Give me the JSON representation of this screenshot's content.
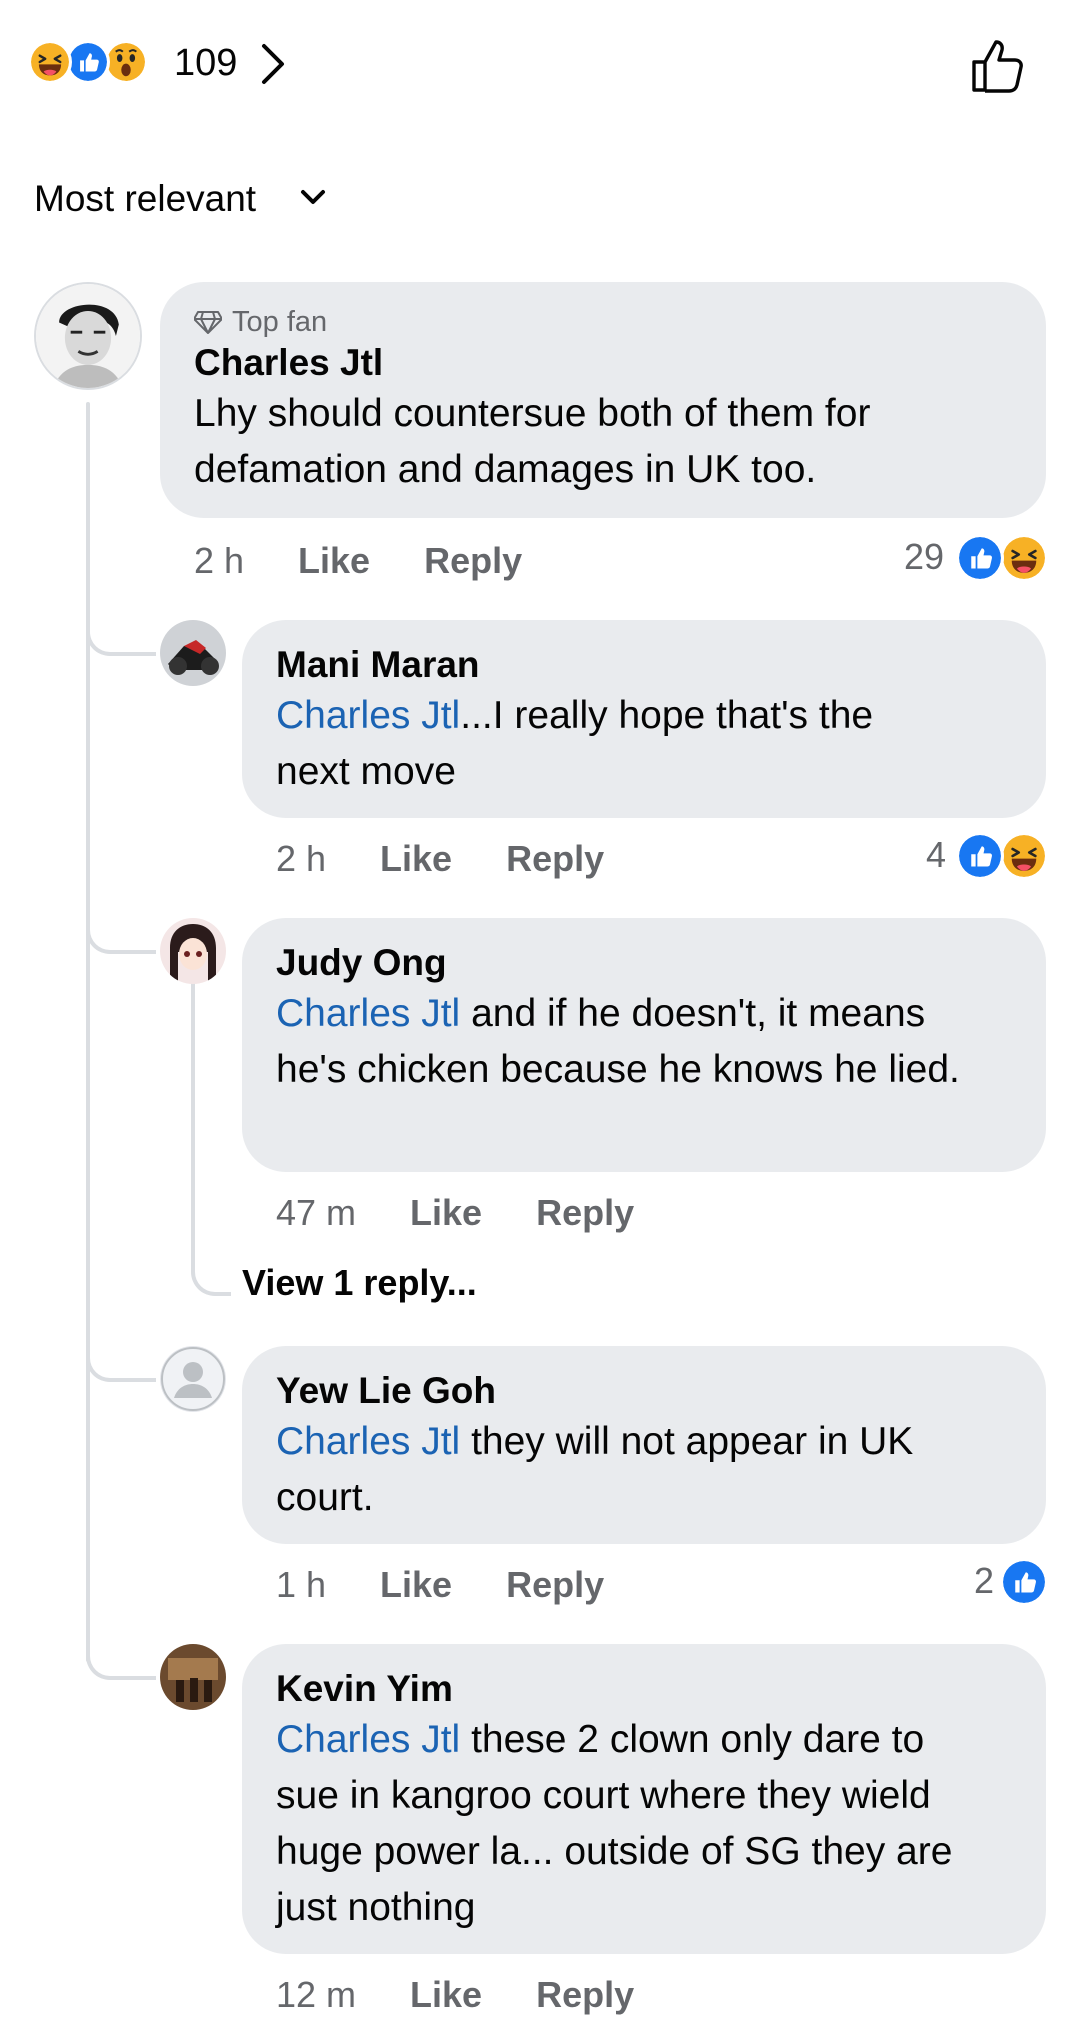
{
  "header": {
    "reaction_count": "109",
    "reaction_icons": [
      "haha-icon",
      "like-icon",
      "wow-icon"
    ]
  },
  "sort": {
    "label": "Most relevant"
  },
  "comment": {
    "badge": "Top fan",
    "author": "Charles Jtl",
    "text": "Lhy should countersue both of them for defamation and damages in UK too.",
    "time": "2 h",
    "like": "Like",
    "reply": "Reply",
    "reaction_count": "29"
  },
  "replies": [
    {
      "author": "Mani Maran",
      "mention": "Charles Jtl",
      "text_line1": "...I really hope that's the",
      "text_rest": "next move",
      "time": "2 h",
      "like": "Like",
      "reply": "Reply",
      "reaction_count": "4"
    },
    {
      "author": "Judy Ong",
      "mention": "Charles Jtl",
      "text_line1": " and if he doesn't, it means",
      "text_rest": "he's chicken because he knows he lied.",
      "time": "47 m",
      "like": "Like",
      "reply": "Reply",
      "view_replies": "View 1 reply..."
    },
    {
      "author": "Yew Lie Goh",
      "mention": "Charles Jtl",
      "text_line1": " they will not appear in UK",
      "text_rest": "court.",
      "time": "1 h",
      "like": "Like",
      "reply": "Reply",
      "reaction_count": "2"
    },
    {
      "author": "Kevin Yim",
      "mention": "Charles Jtl",
      "text_line1": " these 2 clown only dare to",
      "text_rest": "sue in kangroo court where they wield huge power la... outside of SG they are just nothing",
      "time": "12 m",
      "like": "Like",
      "reply": "Reply"
    }
  ],
  "colors": {
    "like_blue": "#1877f2",
    "mention_blue": "#1b63b3",
    "bubble_gray": "#e9ebee",
    "haha_yellow": "#f7b125"
  }
}
